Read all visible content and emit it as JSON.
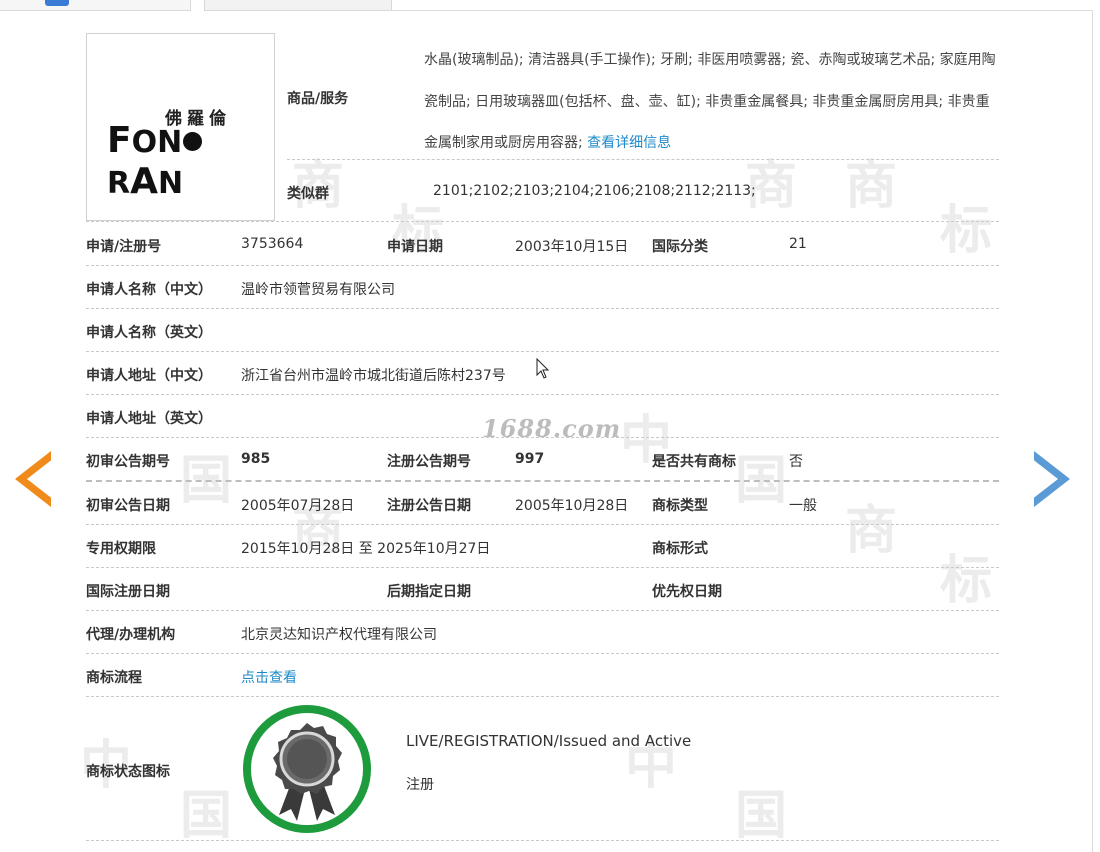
{
  "window": {
    "tabs": [
      {
        "label": ""
      },
      {
        "label": ""
      }
    ]
  },
  "watermark": {
    "site": "1688.com",
    "char1": "中",
    "char2": "国",
    "char3": "商",
    "char4": "标"
  },
  "logo": {
    "cn": "佛羅倫",
    "en_prefix": "F",
    "en_a": "ON",
    "en_b": "R",
    "en_c": "A",
    "en_d": "N"
  },
  "goods": {
    "label": "商品/服务",
    "text": "水晶(玻璃制品); 清洁器具(手工操作); 牙刷; 非医用喷雾器; 瓷、赤陶或玻璃艺术品; 家庭用陶瓷制品; 日用玻璃器皿(包括杯、盘、壶、缸); 非贵重金属餐具; 非贵重金属厨房用具; 非贵重金属制家用或厨房用容器; ",
    "detail_link": "查看详细信息"
  },
  "similar_group": {
    "label": "类似群",
    "value": "2101;2102;2103;2104;2106;2108;2112;2113;"
  },
  "fields": {
    "reg_no_label": "申请/注册号",
    "reg_no": "3753664",
    "apply_date_label": "申请日期",
    "apply_date": "2003年10月15日",
    "intl_class_label": "国际分类",
    "intl_class": "21",
    "applicant_cn_label": "申请人名称（中文）",
    "applicant_cn": "温岭市领菅贸易有限公司",
    "applicant_en_label": "申请人名称（英文）",
    "applicant_en": "",
    "address_cn_label": "申请人地址（中文）",
    "address_cn": "浙江省台州市温岭市城北街道后陈村237号",
    "address_en_label": "申请人地址（英文）",
    "address_en": "",
    "prelim_no_label": "初审公告期号",
    "prelim_no": "985",
    "reg_pub_no_label": "注册公告期号",
    "reg_pub_no": "997",
    "shared_label": "是否共有商标",
    "shared": "否",
    "prelim_date_label": "初审公告日期",
    "prelim_date": "2005年07月28日",
    "reg_pub_date_label": "注册公告日期",
    "reg_pub_date": "2005年10月28日",
    "tm_type_label": "商标类型",
    "tm_type": "一般",
    "exclusive_label": "专用权期限",
    "exclusive": "2015年10月28日 至 2025年10月27日",
    "tm_form_label": "商标形式",
    "tm_form": "",
    "intl_reg_date_label": "国际注册日期",
    "intl_reg_date": "",
    "later_date_label": "后期指定日期",
    "later_date": "",
    "priority_label": "优先权日期",
    "priority": "",
    "agent_label": "代理/办理机构",
    "agent": "北京灵达知识产权代理有限公司",
    "process_label": "商标流程",
    "process_link": "点击查看",
    "status_label": "商标状态图标",
    "status_en": "LIVE/REGISTRATION/Issued and Active",
    "status_cn": "注册"
  },
  "colors": {
    "accent_link": "#1f8ac9",
    "badge_green": "#1e9b3c",
    "arrow_left": "#f08a1b",
    "arrow_right": "#5b9bd5"
  }
}
